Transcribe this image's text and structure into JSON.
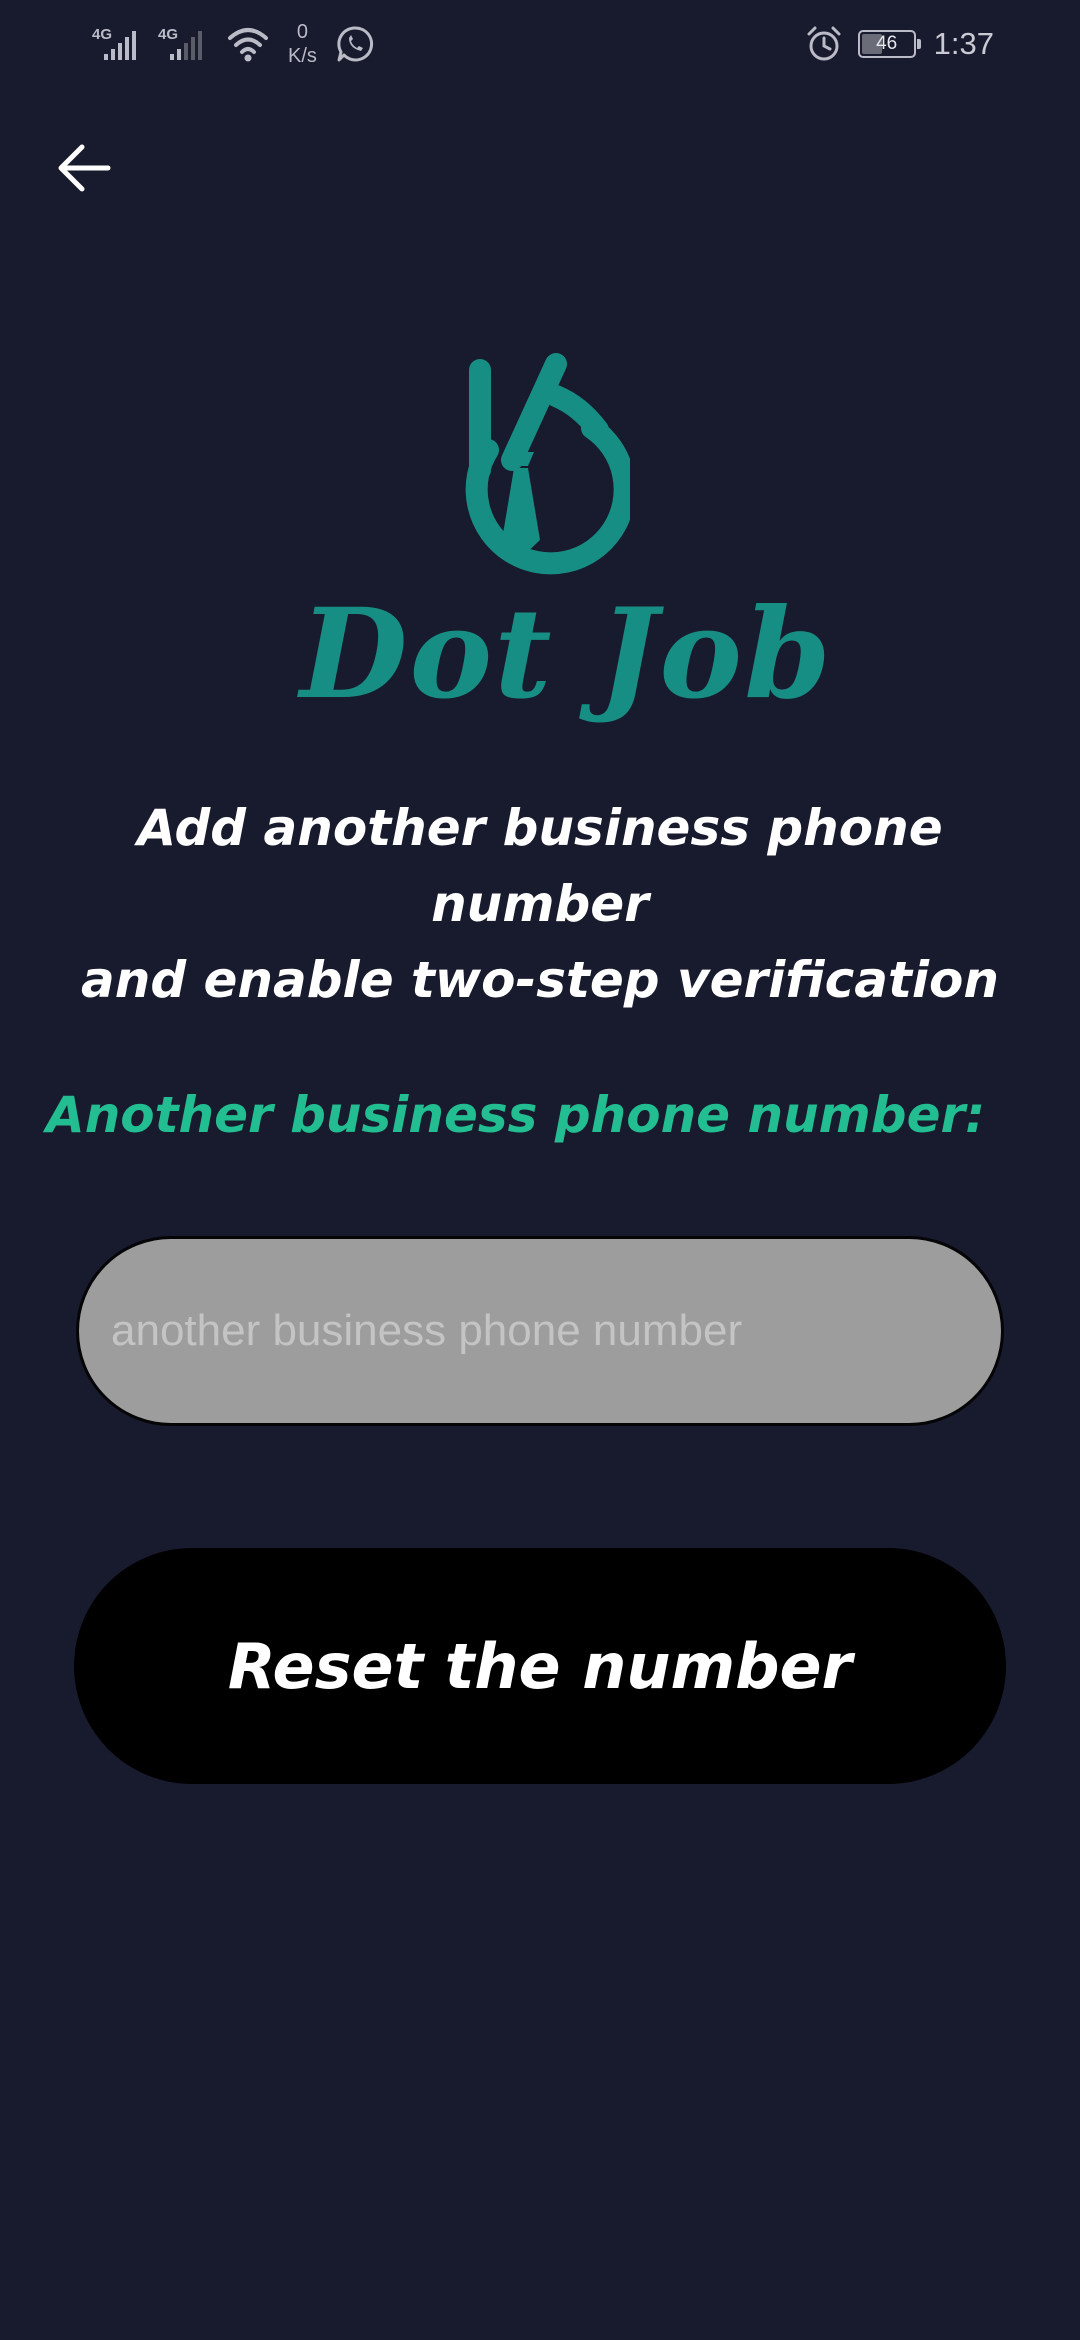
{
  "status_bar": {
    "network_1": "4G",
    "network_2": "4G",
    "speed_value": "0",
    "speed_unit": "K/s",
    "battery_level": "46",
    "battery_percent": 46,
    "time": "1:37",
    "icons": [
      "signal-icon",
      "signal-icon",
      "wifi-icon",
      "whatsapp-icon",
      "alarm-icon",
      "battery-icon"
    ]
  },
  "nav": {
    "back_icon": "arrow-left-icon"
  },
  "logo": {
    "brand_text": "Dot Job",
    "mark_icon": "hand-tie-logo-icon"
  },
  "headline": {
    "line1": "Add another business phone number",
    "line2": "and enable two-step verification"
  },
  "form": {
    "field_label": "Another business phone number:",
    "phone_input": {
      "value": "",
      "placeholder": "another business phone number"
    },
    "reset_button_label": "Reset the number"
  },
  "colors": {
    "background": "#181a2d",
    "brand_teal": "#178e83",
    "label_green": "#23bd92",
    "input_bg": "#9d9d9d",
    "button_bg": "#000000"
  }
}
